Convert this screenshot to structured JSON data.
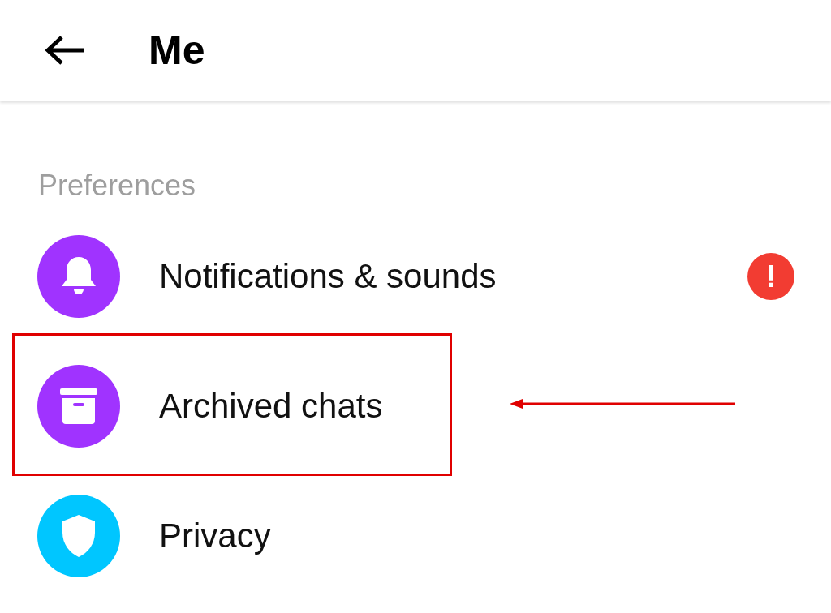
{
  "header": {
    "title": "Me"
  },
  "section": {
    "title": "Preferences"
  },
  "rows": [
    {
      "kind": "bell",
      "label": "Notifications & sounds",
      "color": "#a033ff",
      "badge": "!",
      "highlighted": false
    },
    {
      "kind": "archive",
      "label": "Archived chats",
      "color": "#a033ff",
      "highlighted": true
    },
    {
      "kind": "shield",
      "label": "Privacy",
      "color": "#00c6ff",
      "highlighted": false
    }
  ]
}
